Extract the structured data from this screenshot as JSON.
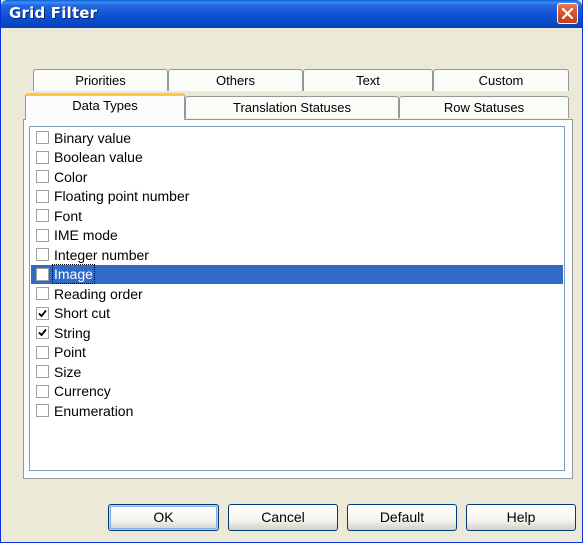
{
  "window": {
    "title": "Grid Filter"
  },
  "tabs": {
    "back_row": [
      {
        "label": "Priorities"
      },
      {
        "label": "Others"
      },
      {
        "label": "Text"
      },
      {
        "label": "Custom"
      }
    ],
    "front_row": [
      {
        "label": "Data Types",
        "active": true
      },
      {
        "label": "Translation Statuses"
      },
      {
        "label": "Row Statuses"
      }
    ]
  },
  "list": {
    "selected_index": 7,
    "items": [
      {
        "label": "Binary value",
        "checked": false
      },
      {
        "label": "Boolean value",
        "checked": false
      },
      {
        "label": "Color",
        "checked": false
      },
      {
        "label": "Floating point number",
        "checked": false
      },
      {
        "label": "Font",
        "checked": false
      },
      {
        "label": "IME mode",
        "checked": false
      },
      {
        "label": "Integer number",
        "checked": false
      },
      {
        "label": "Image",
        "checked": false
      },
      {
        "label": "Reading order",
        "checked": false
      },
      {
        "label": "Short cut",
        "checked": true
      },
      {
        "label": "String",
        "checked": true
      },
      {
        "label": "Point",
        "checked": false
      },
      {
        "label": "Size",
        "checked": false
      },
      {
        "label": "Currency",
        "checked": false
      },
      {
        "label": "Enumeration",
        "checked": false
      }
    ]
  },
  "buttons": {
    "ok": "OK",
    "cancel": "Cancel",
    "default": "Default",
    "help": "Help"
  },
  "colors": {
    "titlebar": "#0a4fd0",
    "selection": "#316ac5",
    "active_tab_accent": "#ffc83c",
    "close_button": "#d75532"
  }
}
